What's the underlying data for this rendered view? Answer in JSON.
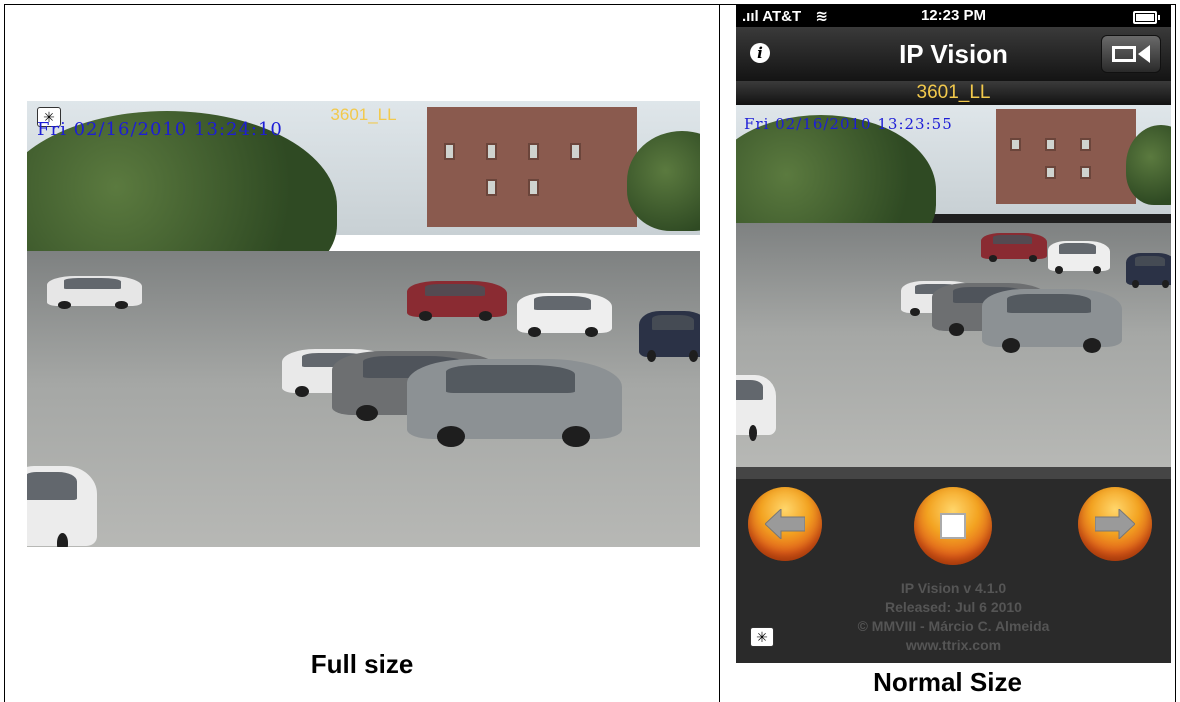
{
  "captions": {
    "left": "Full size",
    "right": "Normal Size"
  },
  "camera": {
    "name": "3601_LL",
    "timestamp_full": "Fri 02/16/2010 13:24:10",
    "timestamp_normal": "Fri 02/16/2010 13:23:55"
  },
  "statusbar": {
    "carrier": "AT&T",
    "time": "12:23 PM"
  },
  "navbar": {
    "title": "IP Vision",
    "info_label": "i"
  },
  "controls": {
    "prev_icon": "left-arrow-icon",
    "stop_icon": "stop-icon",
    "next_icon": "right-arrow-icon"
  },
  "about": {
    "version": "IP Vision v 4.1.0",
    "released": "Released: Jul  6 2010",
    "copyright": "© MMVIII - Márcio C. Almeida",
    "website": "www.ttrix.com"
  },
  "colors": {
    "label_yellow": "#f2c94c",
    "timestamp_blue": "#1d1dd6",
    "orb_orange": "#f3a321"
  }
}
